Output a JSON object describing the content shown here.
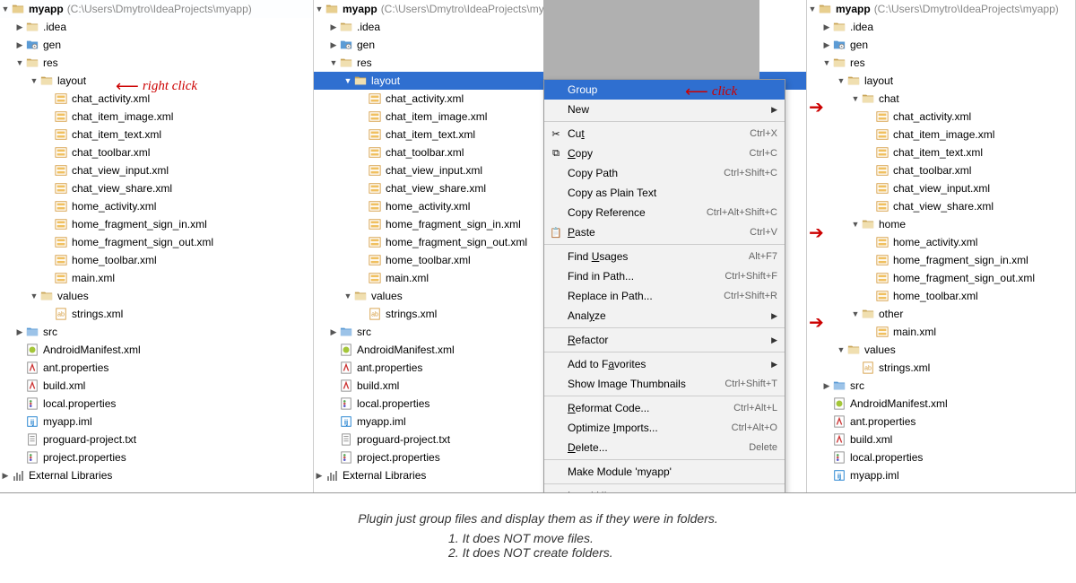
{
  "root": {
    "name": "myapp",
    "path": "(C:\\Users\\Dmytro\\IdeaProjects\\myapp)"
  },
  "tree_common": {
    "idea": ".idea",
    "gen": "gen",
    "res": "res",
    "layout": "layout",
    "values": "values",
    "strings": "strings.xml",
    "src": "src",
    "manifest": "AndroidManifest.xml",
    "ant": "ant.properties",
    "build": "build.xml",
    "local": "local.properties",
    "iml": "myapp.iml",
    "proguard": "proguard-project.txt",
    "projprops": "project.properties",
    "extlibs": "External Libraries"
  },
  "layout_files": [
    "chat_activity.xml",
    "chat_item_image.xml",
    "chat_item_text.xml",
    "chat_toolbar.xml",
    "chat_view_input.xml",
    "chat_view_share.xml",
    "home_activity.xml",
    "home_fragment_sign_in.xml",
    "home_fragment_sign_out.xml",
    "home_toolbar.xml",
    "main.xml"
  ],
  "groups": {
    "chat": {
      "label": "chat",
      "files": [
        "chat_activity.xml",
        "chat_item_image.xml",
        "chat_item_text.xml",
        "chat_toolbar.xml",
        "chat_view_input.xml",
        "chat_view_share.xml"
      ]
    },
    "home": {
      "label": "home",
      "files": [
        "home_activity.xml",
        "home_fragment_sign_in.xml",
        "home_fragment_sign_out.xml",
        "home_toolbar.xml"
      ]
    },
    "other": {
      "label": "other",
      "files": [
        "main.xml"
      ]
    }
  },
  "annotations": {
    "right_click": "right click",
    "click": "click"
  },
  "context_menu": [
    {
      "label": "Group",
      "highlighted": true
    },
    {
      "label": "New",
      "submenu": true
    },
    {
      "sep": true
    },
    {
      "label": "Cut",
      "shortcut": "Ctrl+X",
      "icon": "✂",
      "u": 2
    },
    {
      "label": "Copy",
      "shortcut": "Ctrl+C",
      "icon": "⧉",
      "u": 0
    },
    {
      "label": "Copy Path",
      "shortcut": "Ctrl+Shift+C"
    },
    {
      "label": "Copy as Plain Text"
    },
    {
      "label": "Copy Reference",
      "shortcut": "Ctrl+Alt+Shift+C"
    },
    {
      "label": "Paste",
      "shortcut": "Ctrl+V",
      "icon": "📋",
      "u": 0
    },
    {
      "sep": true
    },
    {
      "label": "Find Usages",
      "shortcut": "Alt+F7",
      "u": 5
    },
    {
      "label": "Find in Path...",
      "shortcut": "Ctrl+Shift+F"
    },
    {
      "label": "Replace in Path...",
      "shortcut": "Ctrl+Shift+R"
    },
    {
      "label": "Analyze",
      "submenu": true,
      "u": 4
    },
    {
      "sep": true
    },
    {
      "label": "Refactor",
      "submenu": true,
      "u": 0
    },
    {
      "sep": true
    },
    {
      "label": "Add to Favorites",
      "submenu": true,
      "u": 8
    },
    {
      "label": "Show Image Thumbnails",
      "shortcut": "Ctrl+Shift+T"
    },
    {
      "sep": true
    },
    {
      "label": "Reformat Code...",
      "shortcut": "Ctrl+Alt+L",
      "u": 0
    },
    {
      "label": "Optimize Imports...",
      "shortcut": "Ctrl+Alt+O",
      "u": 9
    },
    {
      "label": "Delete...",
      "shortcut": "Delete",
      "u": 0
    },
    {
      "sep": true
    },
    {
      "label": "Make Module 'myapp'"
    },
    {
      "sep": true
    },
    {
      "label": "Local History",
      "submenu": true,
      "u": 6
    },
    {
      "sep": true
    }
  ],
  "footer": {
    "main": "Plugin just group files and display them as if they were in folders.",
    "line1": "1. It does NOT move files.",
    "line2": "2. It does NOT create folders."
  }
}
